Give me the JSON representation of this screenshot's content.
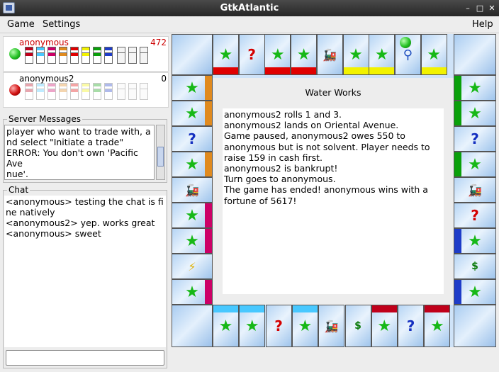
{
  "window": {
    "title": "GtkAtlantic"
  },
  "menu": {
    "game": "Game",
    "settings": "Settings",
    "help": "Help"
  },
  "players": [
    {
      "name": "anonymous",
      "money": "472",
      "color": "#22cc22",
      "name_color": "#cc0000"
    },
    {
      "name": "anonymous2",
      "money": "0",
      "color": "#d01010",
      "name_color": "#000000"
    }
  ],
  "server_messages": {
    "label": "Server Messages",
    "text": "player who want to trade with, a\nnd select \"Initiate a trade\"\nERROR: You don't own 'Pacific Ave\nnue'."
  },
  "chat": {
    "label": "Chat",
    "text": "<anonymous> testing the chat is fi\nne natively\n<anonymous2> yep. works great\n<anonymous> sweet",
    "input_value": ""
  },
  "board": {
    "estate_name": "Water Works",
    "log": "anonymous2 rolls 1 and 3.\nanonymous2 lands on Oriental Avenue.\nGame paused, anonymous2 owes 550 to\nanonymous but is not solvent. Player needs to\nraise 159 in cash first.\nanonymous2 is bankrupt!\nTurn goes to anonymous.\nThe game has ended! anonymous wins with a\nfortune of 5617!",
    "icons": {
      "chance": "?",
      "community": "?"
    }
  },
  "colors": {
    "star": "#17b817",
    "brown": "#c0001a",
    "lightblue": "#48c8ff",
    "pink": "#cc0066",
    "orange": "#e08a1e",
    "red": "#e00000",
    "yellow": "#f2f200",
    "green": "#0aa00a",
    "blue": "#1e3cc8"
  }
}
